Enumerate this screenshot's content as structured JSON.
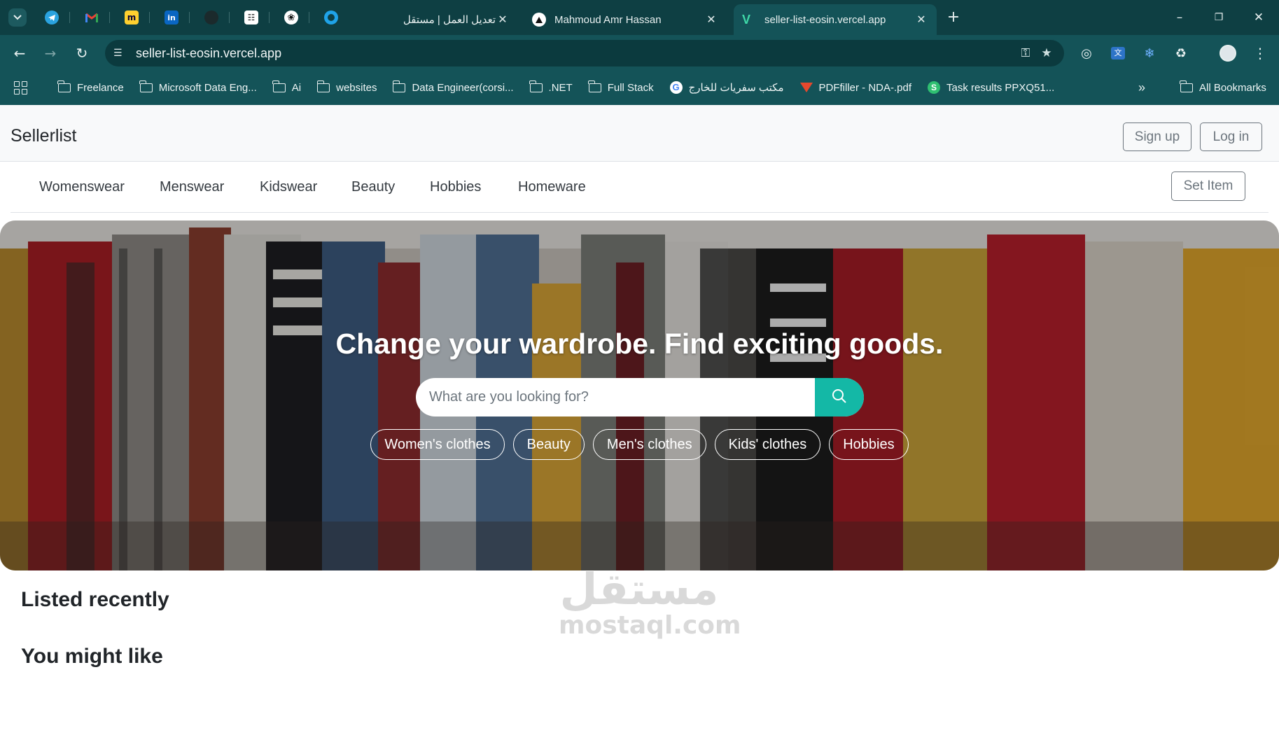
{
  "browser": {
    "tabs": [
      {
        "title": "تعديل العمل | مستقل",
        "favicon": "mostaql-icon"
      },
      {
        "title": "Mahmoud Amr Hassan",
        "favicon": "triangle-icon"
      },
      {
        "title": "seller-list-eosin.vercel.app",
        "favicon": "vercel-v-icon",
        "active": true
      }
    ],
    "pinned_tabs": [
      "telegram-icon",
      "gmail-icon",
      "miro-icon",
      "linkedin-icon",
      "github-icon",
      "upwork-icon",
      "chatgpt-icon",
      "circle-app-icon"
    ],
    "url": "seller-list-eosin.vercel.app",
    "bookmarks": [
      {
        "label": "Freelance",
        "icon": "folder-icon"
      },
      {
        "label": "Microsoft Data Eng...",
        "icon": "folder-icon"
      },
      {
        "label": "Ai",
        "icon": "folder-icon"
      },
      {
        "label": "websites",
        "icon": "folder-icon"
      },
      {
        "label": "Data Engineer(corsi...",
        "icon": "folder-icon"
      },
      {
        "label": ".NET",
        "icon": "folder-icon"
      },
      {
        "label": "Full Stack",
        "icon": "folder-icon"
      },
      {
        "label": "مكتب سفريات للخارج",
        "icon": "google-icon"
      },
      {
        "label": "PDFfiller - NDA-.pdf",
        "icon": "pdffiller-icon"
      },
      {
        "label": "Task results PPXQ51...",
        "icon": "s-app-icon"
      }
    ],
    "all_bookmarks_label": "All Bookmarks",
    "accent": "#145358",
    "tabbar_bg": "#0e3f43"
  },
  "site": {
    "brand": "Sellerlist",
    "signup_label": "Sign up",
    "login_label": "Log in",
    "set_item_label": "Set Item",
    "categories": [
      "Womenswear",
      "Menswear",
      "Kidswear",
      "Beauty",
      "Hobbies",
      "Homeware"
    ]
  },
  "hero": {
    "title": "Change your wardrobe. Find exciting goods.",
    "search_placeholder": "What are you looking for?",
    "search_button_color": "#14b8a6",
    "pills": [
      "Women's clothes",
      "Beauty",
      "Men's clothes",
      "Kids' clothes",
      "Hobbies"
    ]
  },
  "sections": {
    "listed_recently": "Listed recently",
    "you_might_like": "You might like"
  },
  "watermark": {
    "arabic": "مستقل",
    "latin": "mostaql.com"
  }
}
